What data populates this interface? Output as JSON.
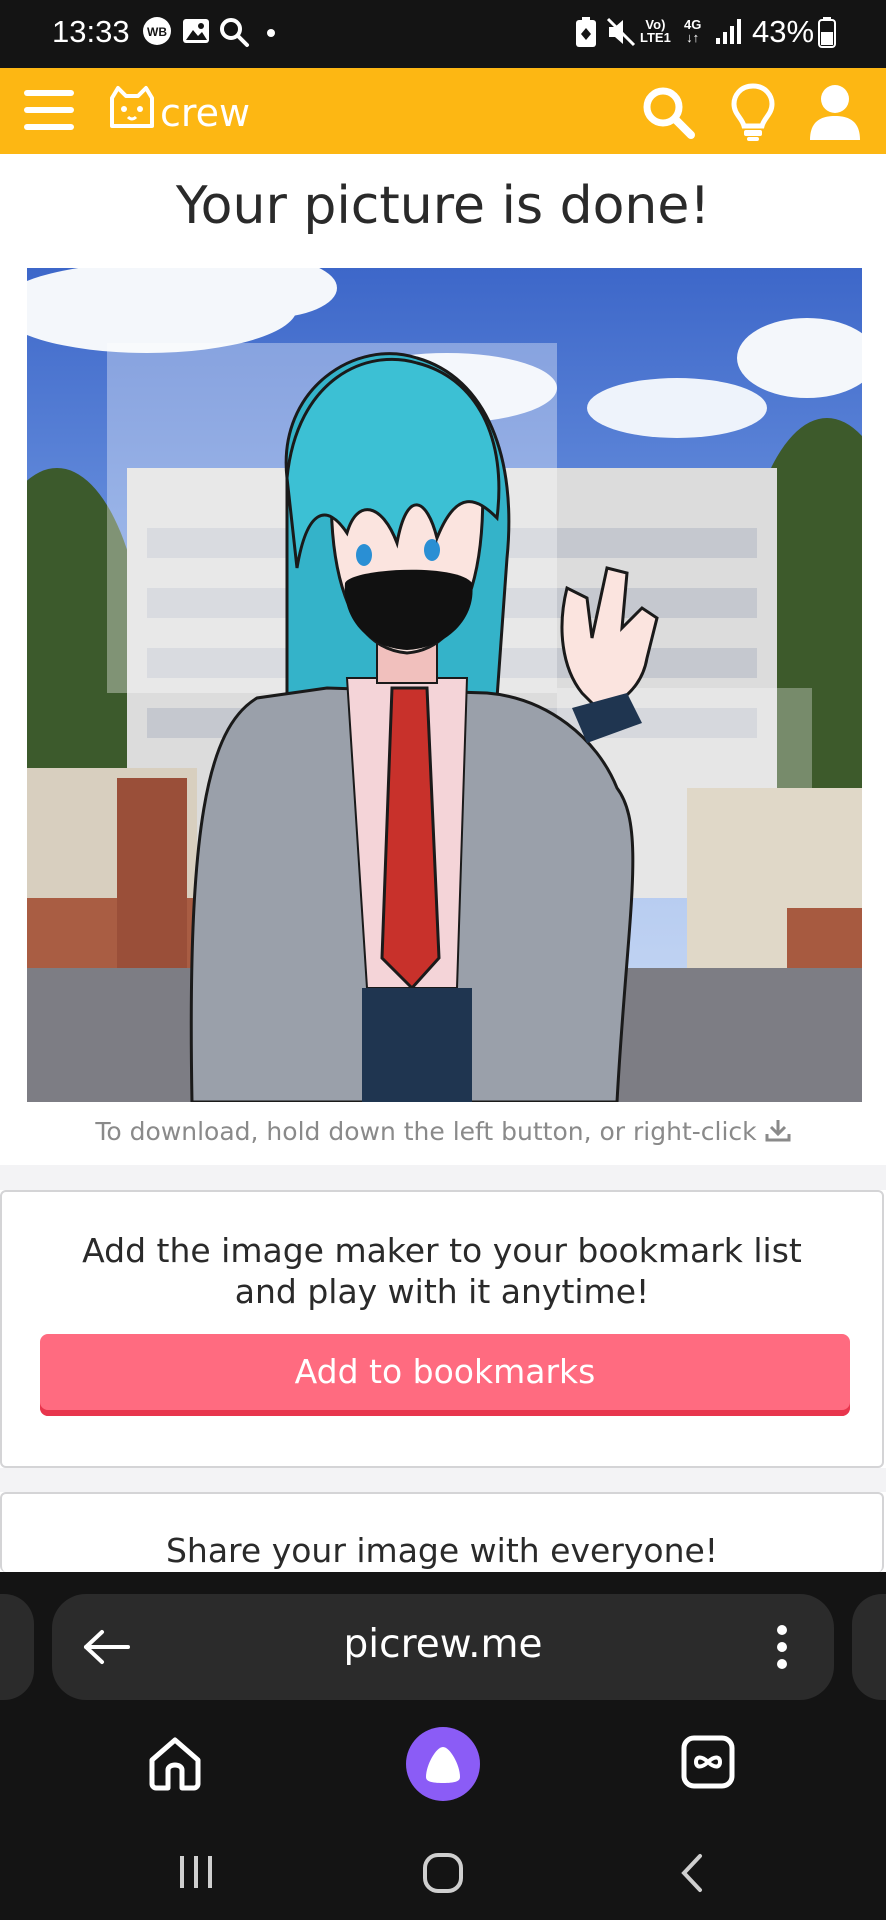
{
  "status_bar": {
    "time": "13:33",
    "net_top": "Vo)",
    "net_bottom": "LTE1",
    "net2_top": "4G",
    "net2_bottom": "↓↑",
    "battery": "43%"
  },
  "header": {
    "logo": "Picrew",
    "icons": [
      "menu-icon",
      "search-icon",
      "lightbulb-icon",
      "user-icon"
    ],
    "color": "#FDB713"
  },
  "main": {
    "title": "Your picture is done!",
    "download_hint": "To download, hold down the left button, or right-click",
    "bookmark_card": {
      "text_line1": "Add the image maker to your bookmark list",
      "text_line2": "and play with it anytime!",
      "button_label": "Add to bookmarks"
    },
    "share_card": {
      "text": "Share your image with everyone!"
    }
  },
  "browser": {
    "url": "picrew.me",
    "nav_icons": [
      "back-arrow-icon",
      "more-vertical-icon",
      "home-icon",
      "assistant-icon",
      "tabs-icon"
    ]
  },
  "system_nav": {
    "icons": [
      "recents-icon",
      "home-circle-icon",
      "back-chevron-icon"
    ]
  },
  "colors": {
    "accent": "#FDB713",
    "button": "#FF6B80",
    "assistant": "#8B5CF6"
  }
}
